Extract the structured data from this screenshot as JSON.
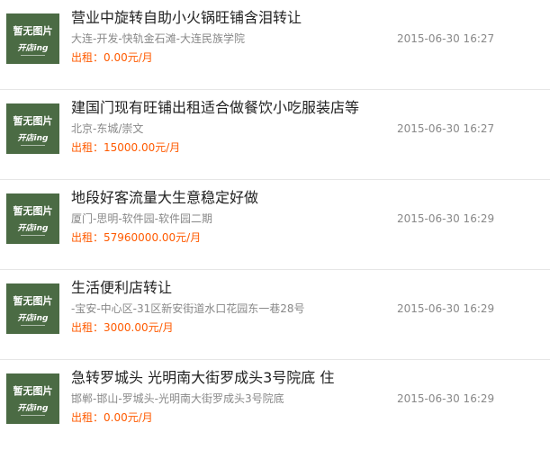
{
  "colors": {
    "thumbnail_bg": "#4b6b44",
    "price": "#ff5a00",
    "meta": "#888888",
    "title": "#222222"
  },
  "thumbnail": {
    "top_text": "暂无图片",
    "bottom_text": "开店ing"
  },
  "listings": [
    {
      "title": "营业中旋转自助小火锅旺铺含泪转让",
      "location": "大连-开发-快轨金石滩-大连民族学院",
      "price": "出租：0.00元/月",
      "date": "2015-06-30 16:27"
    },
    {
      "title": "建国门现有旺铺出租适合做餐饮小吃服装店等",
      "location": "北京-东城/崇文",
      "price": "出租：15000.00元/月",
      "date": "2015-06-30 16:27"
    },
    {
      "title": "地段好客流量大生意稳定好做",
      "location": "厦门-思明-软件园-软件园二期",
      "price": "出租：57960000.00元/月",
      "date": "2015-06-30 16:29"
    },
    {
      "title": "生活便利店转让",
      "location": "-宝安-中心区-31区新安街道水口花园东一巷28号",
      "price": "出租：3000.00元/月",
      "date": "2015-06-30 16:29"
    },
    {
      "title": "急转罗城头 光明南大街罗成头3号院底 住",
      "location": "邯郸-邯山-罗城头-光明南大街罗成头3号院底",
      "price": "出租：0.00元/月",
      "date": "2015-06-30 16:29"
    }
  ]
}
